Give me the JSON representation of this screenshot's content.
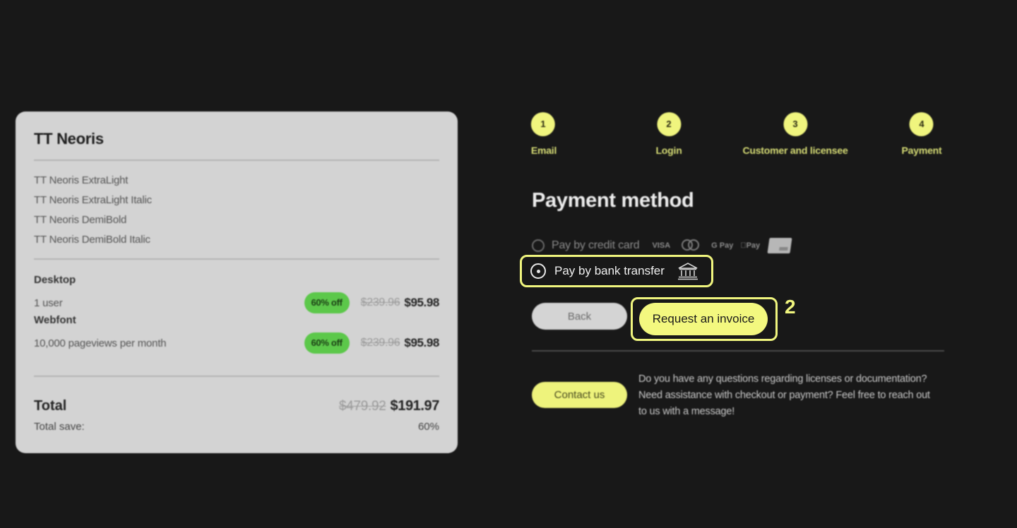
{
  "summary": {
    "font_family_name": "TT Neoris",
    "styles": [
      "TT Neoris ExtraLight",
      "TT Neoris ExtraLight Italic",
      "TT Neoris DemiBold",
      "TT Neoris DemiBold Italic"
    ],
    "licenses": [
      {
        "type": "Desktop",
        "detail": "1 user",
        "discount": "60% off",
        "old_price": "$239.96",
        "new_price": "$95.98"
      },
      {
        "type": "Webfont",
        "detail": "10,000 pageviews per month",
        "discount": "60% off",
        "old_price": "$239.96",
        "new_price": "$95.98"
      }
    ],
    "total_label": "Total",
    "total_old": "$479.92",
    "total_new": "$191.97",
    "save_label": "Total save:",
    "save_value": "60%"
  },
  "stepper": [
    {
      "num": "1",
      "label": "Email"
    },
    {
      "num": "2",
      "label": "Login"
    },
    {
      "num": "3",
      "label": "Customer and licensee"
    },
    {
      "num": "4",
      "label": "Payment"
    }
  ],
  "payment": {
    "title": "Payment method",
    "credit_card_label": "Pay by credit card",
    "brands": [
      "VISA",
      "Mastercard",
      "G Pay",
      "Apple Pay",
      "Card"
    ],
    "brand_text": {
      "visa": "VISA",
      "gpay": "G Pay",
      "applepay": "Pay"
    },
    "bank_label": "Pay by bank transfer",
    "selected": "bank_transfer"
  },
  "actions": {
    "back": "Back",
    "invoice": "Request an invoice",
    "annotation": "2"
  },
  "contact": {
    "button": "Contact us",
    "text": "Do you have any questions regarding licenses or documentation? Need assistance with checkout or payment? Feel free to reach out to us with a message!"
  },
  "colors": {
    "accent": "#f0f57e",
    "badge": "#5cc84a",
    "background": "#181818",
    "card": "#d3d3d3"
  }
}
